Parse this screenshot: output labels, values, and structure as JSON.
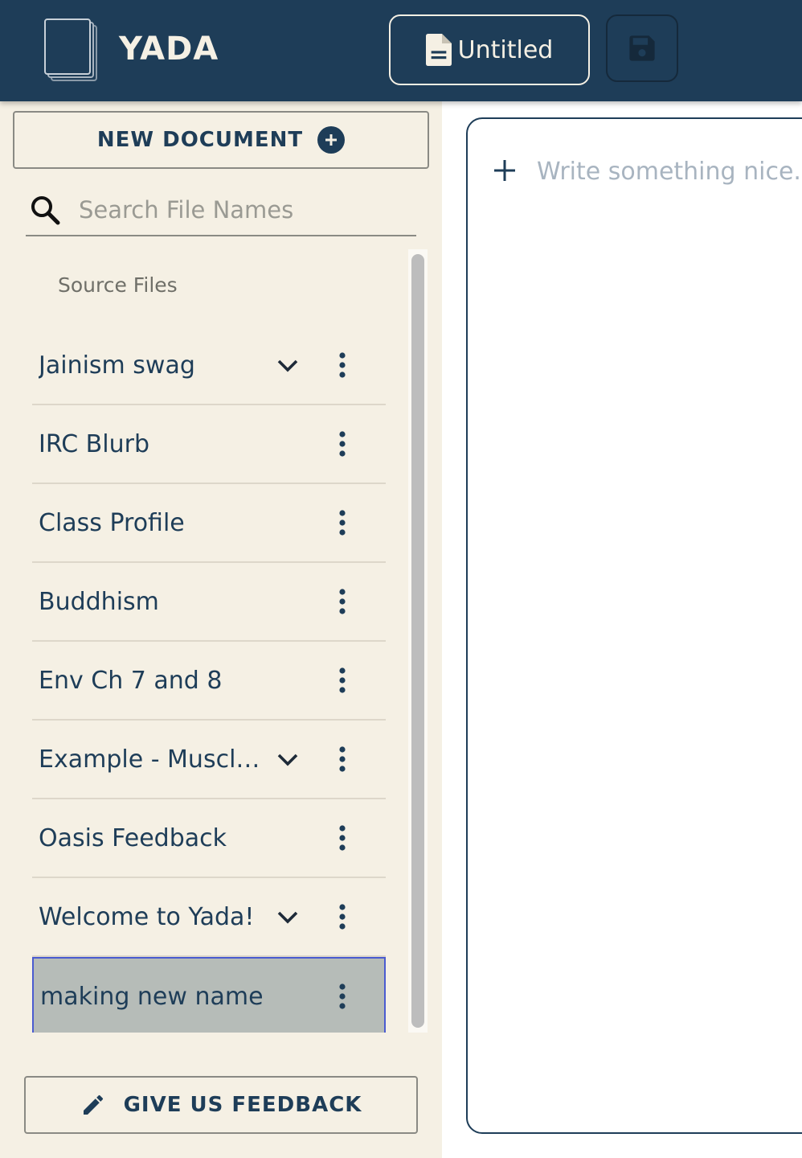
{
  "header": {
    "brand": "YADA",
    "document_title": "Untitled"
  },
  "sidebar": {
    "new_document_label": "NEW DOCUMENT",
    "search_placeholder": "Search File Names",
    "section_label": "Source Files",
    "files": [
      {
        "name": "Jainism swag",
        "expandable": true
      },
      {
        "name": "IRC Blurb",
        "expandable": false
      },
      {
        "name": "Class Profile",
        "expandable": false
      },
      {
        "name": "Buddhism",
        "expandable": false
      },
      {
        "name": "Env Ch 7 and 8",
        "expandable": false
      },
      {
        "name": "Example - Muscle...",
        "expandable": true
      },
      {
        "name": "Oasis Feedback",
        "expandable": false
      },
      {
        "name": "Welcome to Yada!",
        "expandable": true
      },
      {
        "name": "making new name",
        "expandable": false,
        "selected": true
      }
    ],
    "feedback_label": "GIVE US FEEDBACK"
  },
  "editor": {
    "placeholder": "Write something nice..."
  },
  "colors": {
    "primary": "#1e3d58",
    "sidebar_bg": "#f5f0e4",
    "selected_bg": "#b6bcb8"
  }
}
